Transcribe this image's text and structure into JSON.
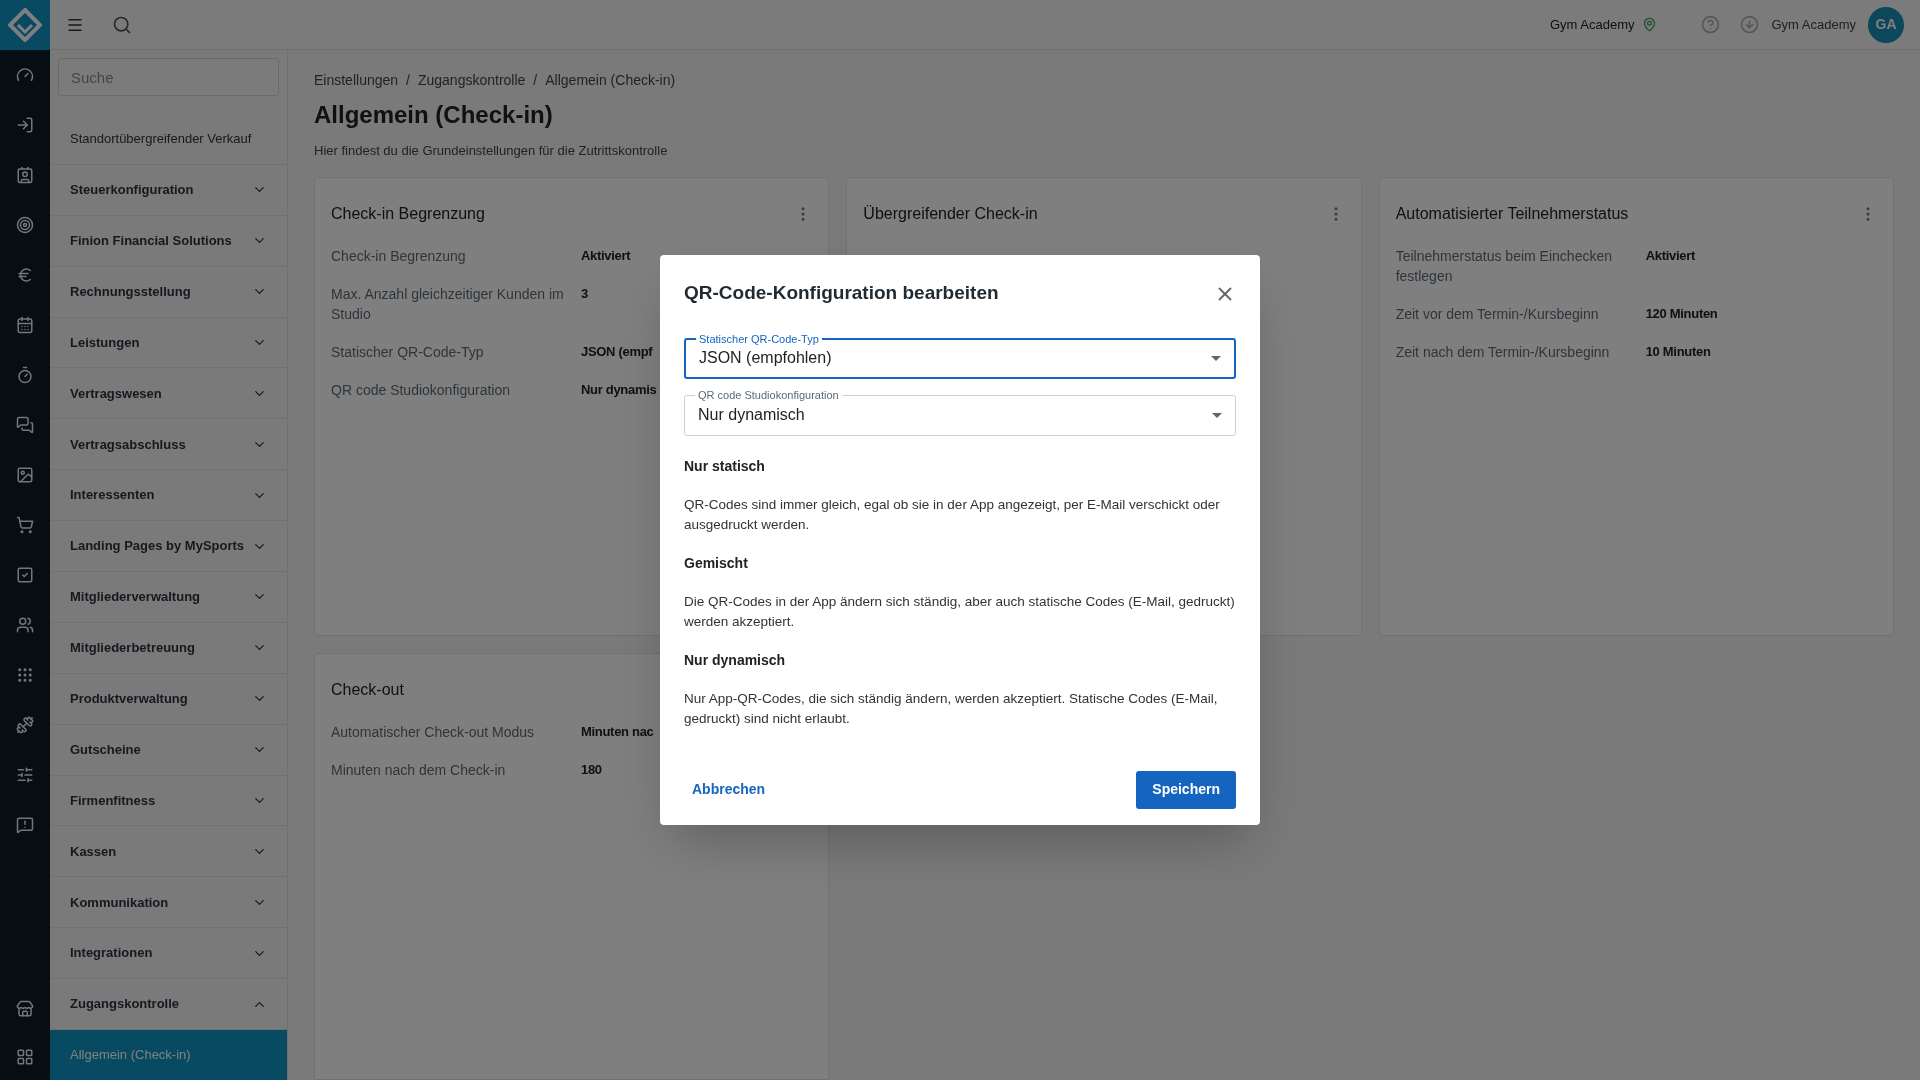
{
  "topbar": {
    "location": "Gym Academy",
    "user": "Gym Academy",
    "avatar": "GA"
  },
  "sidebar": {
    "search_placeholder": "Suche",
    "items": [
      {
        "label": "Standortübergreifender Verkauf",
        "kind": "link"
      },
      {
        "label": "Steuerkonfiguration",
        "kind": "group",
        "expanded": false
      },
      {
        "label": "Finion Financial Solutions",
        "kind": "group",
        "expanded": false
      },
      {
        "label": "Rechnungsstellung",
        "kind": "group",
        "expanded": false
      },
      {
        "label": "Leistungen",
        "kind": "group",
        "expanded": false
      },
      {
        "label": "Vertragswesen",
        "kind": "group",
        "expanded": false
      },
      {
        "label": "Vertragsabschluss",
        "kind": "group",
        "expanded": false
      },
      {
        "label": "Interessenten",
        "kind": "group",
        "expanded": false
      },
      {
        "label": "Landing Pages by MySports",
        "kind": "group",
        "expanded": false
      },
      {
        "label": "Mitgliederverwaltung",
        "kind": "group",
        "expanded": false
      },
      {
        "label": "Mitgliederbetreuung",
        "kind": "group",
        "expanded": false
      },
      {
        "label": "Produktverwaltung",
        "kind": "group",
        "expanded": false
      },
      {
        "label": "Gutscheine",
        "kind": "group",
        "expanded": false
      },
      {
        "label": "Firmenfitness",
        "kind": "group",
        "expanded": false
      },
      {
        "label": "Kassen",
        "kind": "group",
        "expanded": false
      },
      {
        "label": "Kommunikation",
        "kind": "group",
        "expanded": false
      },
      {
        "label": "Integrationen",
        "kind": "group",
        "expanded": false
      },
      {
        "label": "Zugangskontrolle",
        "kind": "group",
        "expanded": true,
        "children": [
          {
            "label": "Allgemein (Check-in)",
            "selected": true
          }
        ]
      }
    ]
  },
  "breadcrumbs": {
    "separator": "/",
    "items": [
      "Einstellungen",
      "Zugangskontrolle",
      "Allgemein (Check-in)"
    ]
  },
  "page": {
    "title": "Allgemein (Check-in)",
    "subtitle": "Hier findest du die Grundeinstellungen für die Zutrittskontrolle"
  },
  "cards": [
    {
      "title": "Check-in Begrenzung",
      "rows": [
        {
          "label": "Check-in Begrenzung",
          "value": "Aktiviert"
        },
        {
          "label": "Max. Anzahl gleichzeitiger Kunden im Studio",
          "value": "3"
        },
        {
          "label": "Statischer QR-Code-Typ",
          "value": "JSON (empf"
        },
        {
          "label": "QR code Studiokonfiguration",
          "value": "Nur dynamis"
        }
      ]
    },
    {
      "title": "Übergreifender Check-in"
    },
    {
      "title": "Automatisierter Teilnehmerstatus",
      "rows": [
        {
          "label": "Teilnehmerstatus beim Einchecken festlegen",
          "value": "Aktiviert"
        },
        {
          "label": "Zeit vor dem Termin-/Kursbeginn",
          "value": "120 Minuten"
        },
        {
          "label": "Zeit nach dem Termin-/Kursbeginn",
          "value": "10 Minuten"
        }
      ]
    },
    {
      "title": "Check-out",
      "rows": [
        {
          "label": "Automatischer Check-out Modus",
          "value": "Minuten nac"
        },
        {
          "label": "Minuten nach dem Check-in",
          "value": "180"
        }
      ]
    }
  ],
  "dialog": {
    "title": "QR-Code-Konfiguration bearbeiten",
    "fields": [
      {
        "label": "Statischer QR-Code-Typ",
        "value": "JSON (empfohlen)",
        "focused": true
      },
      {
        "label": "QR code Studiokonfiguration",
        "value": "Nur dynamisch",
        "focused": false
      }
    ],
    "sections": [
      {
        "heading": "Nur statisch",
        "text": "QR-Codes sind immer gleich, egal ob sie in der App angezeigt, per E-Mail verschickt oder ausgedruckt werden."
      },
      {
        "heading": "Gemischt",
        "text": "Die QR-Codes in der App ändern sich ständig, aber auch statische Codes (E-Mail, gedruckt) werden akzeptiert."
      },
      {
        "heading": "Nur dynamisch",
        "text": "Nur App-QR-Codes, die sich ständig ändern, werden akzeptiert. Statische Codes (E-Mail, gedruckt) sind nicht erlaubt."
      }
    ],
    "cancel": "Abbrechen",
    "save": "Speichern"
  }
}
